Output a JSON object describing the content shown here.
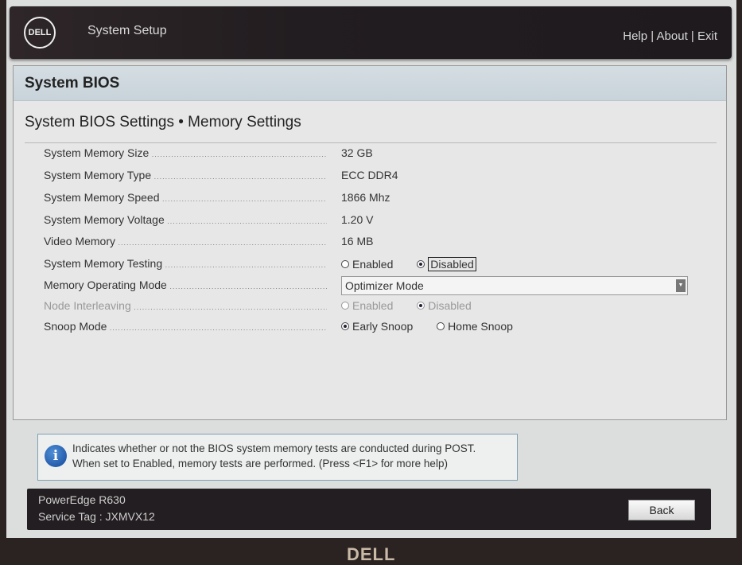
{
  "header": {
    "logo": "DELL",
    "title": "System Setup",
    "links": [
      "Help",
      "About",
      "Exit"
    ],
    "separator": "|"
  },
  "panel": {
    "title": "System BIOS",
    "subtitle": "System BIOS Settings • Memory Settings"
  },
  "settings": [
    {
      "label": "System Memory Size",
      "value": "32 GB"
    },
    {
      "label": "System Memory Type",
      "value": "ECC DDR4"
    },
    {
      "label": "System Memory Speed",
      "value": "1866 Mhz"
    },
    {
      "label": "System Memory Voltage",
      "value": "1.20 V"
    },
    {
      "label": "Video Memory",
      "value": "16 MB"
    },
    {
      "label": "System Memory Testing",
      "options": [
        "Enabled",
        "Disabled"
      ],
      "selected": "Disabled"
    },
    {
      "label": "Memory Operating Mode",
      "value": "Optimizer Mode"
    },
    {
      "label": "Node Interleaving",
      "options": [
        "Enabled",
        "Disabled"
      ],
      "selected": "Disabled",
      "disabled": true
    },
    {
      "label": "Snoop Mode",
      "options": [
        "Early Snoop",
        "Home Snoop"
      ],
      "selected": "Early Snoop"
    }
  ],
  "help": {
    "icon": "info-icon",
    "line1": "Indicates whether or not the BIOS system memory tests are conducted during POST.",
    "line2": "When set to Enabled, memory tests are performed. (Press <F1> for more help)"
  },
  "footer": {
    "model": "PowerEdge R630",
    "service_tag": "Service Tag : JXMVX12",
    "back_label": "Back"
  },
  "bezel": {
    "logo": "DELL"
  },
  "colors": {
    "header_bg": "#231e21",
    "panel_title_bg": "#cdd7dd",
    "info_blue": "#1a56a8"
  }
}
